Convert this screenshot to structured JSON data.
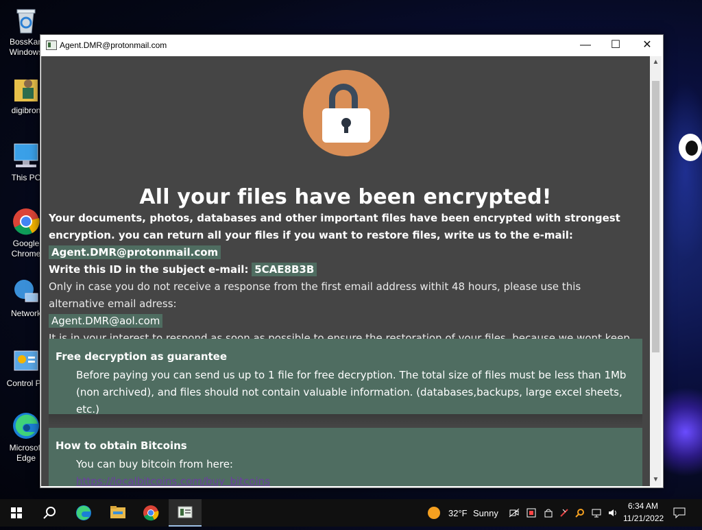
{
  "desktop": {
    "icons": [
      {
        "label": "BossKan\nWindows",
        "icon": "recycle-bin-icon"
      },
      {
        "label": "digibron",
        "icon": "user-folder-icon"
      },
      {
        "label": "This PC",
        "icon": "computer-icon"
      },
      {
        "label": "Google\nChrome",
        "icon": "chrome-icon"
      },
      {
        "label": "Network",
        "icon": "network-icon"
      },
      {
        "label": "Control Pa",
        "icon": "control-panel-icon"
      },
      {
        "label": "Microsoft\nEdge",
        "icon": "edge-icon"
      }
    ]
  },
  "window": {
    "title": "Agent.DMR@protonmail.com",
    "controls": {
      "minimize": "—",
      "maximize": "☐",
      "close": "✕"
    }
  },
  "ransom": {
    "headline": "All your files have been encrypted!",
    "p1_text": "Your documents, photos, databases and other important files have been encrypted with strongest encryption. you can return all your files if you want to restore files, write us to the e-mail:",
    "email_primary": "Agent.DMR@protonmail.com",
    "id_label": "Write this ID in the subject e-mail:",
    "id_value": "5CAE8B3B",
    "alt_text": "Only in case you do not receive a response from the first email address withit 48 hours, please use this alternative email adress:",
    "email_alt": "Agent.DMR@aol.com",
    "interest_text": "It is in your interest to respond as soon as possible to ensure the restoration of your files, because we wont keep your decryption keys at our server more than one week. The price depends on how fast you write to us.",
    "section1_title": "Free decryption as guarantee",
    "section1_text": "Before paying you can send us up to 1 file for free decryption. The total size of files must be less than 1Mb (non archived), and files should not contain valuable information. (databases,backups, large excel sheets, etc.)",
    "section2_title": "How to obtain Bitcoins",
    "section2_text": "You can buy bitcoin from here:",
    "section2_link": "https://localbitcoins.com/buy_bitcoins"
  },
  "taskbar": {
    "weather_temp": "32°F",
    "weather_text": "Sunny",
    "time": "6:34 AM",
    "date": "11/21/2022"
  },
  "colors": {
    "accent_box": "#4f6d61",
    "lock_circle": "#d98e56",
    "content_bg": "#454545"
  }
}
